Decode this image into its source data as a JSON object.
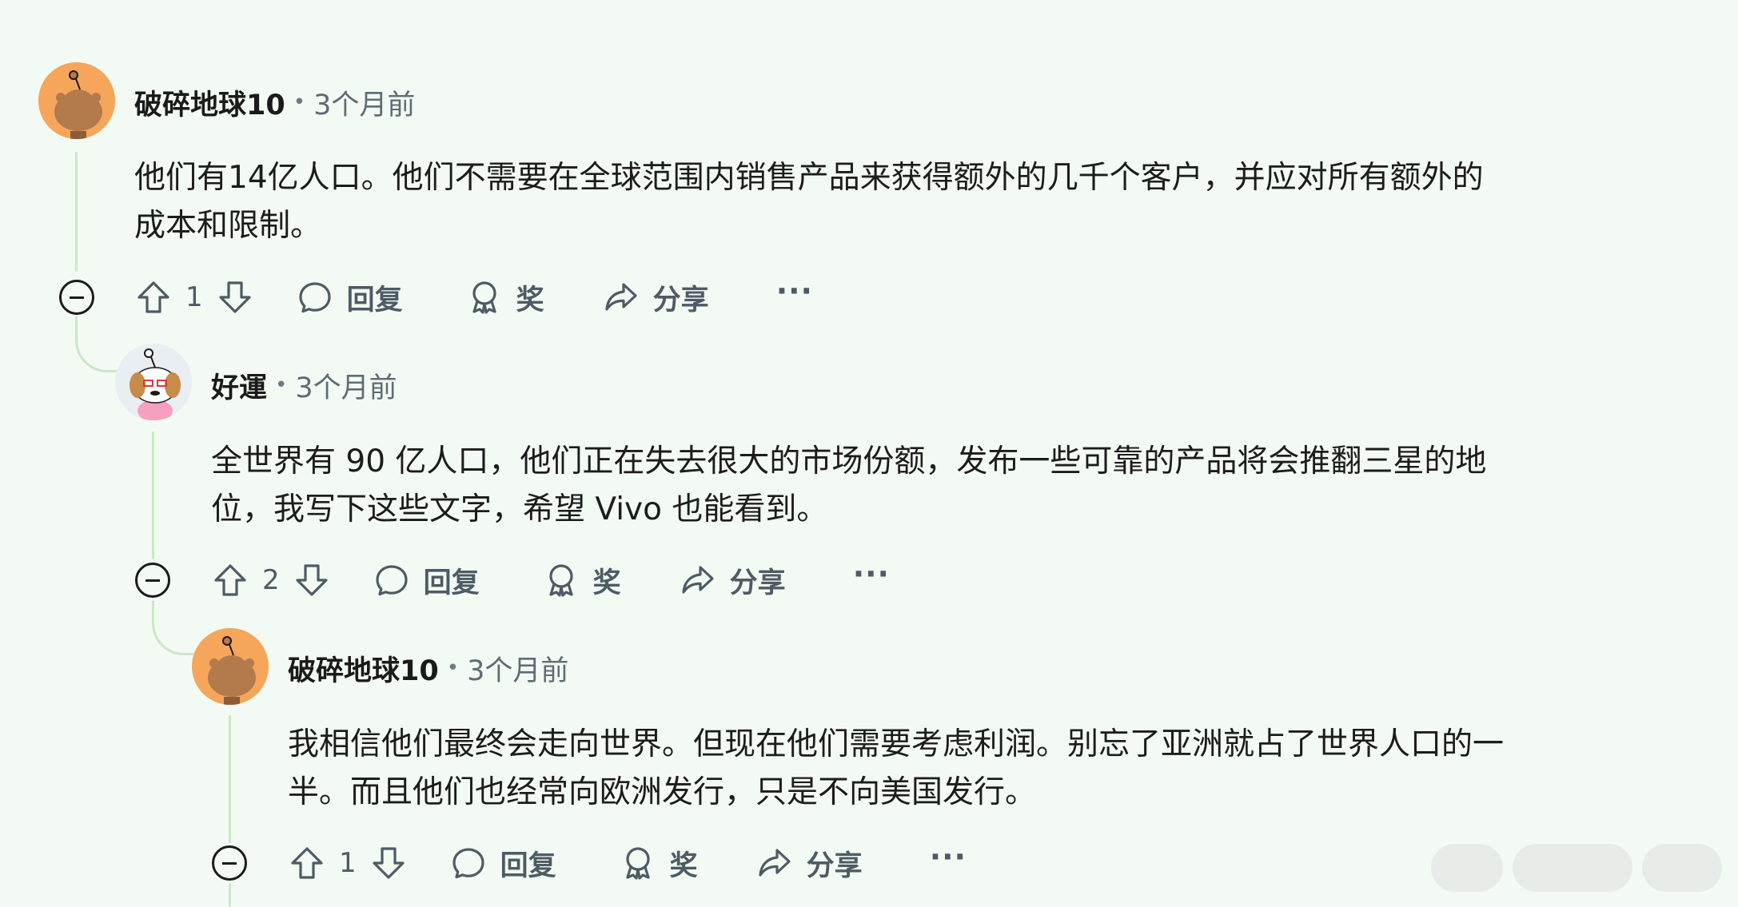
{
  "comments": [
    {
      "author": "破碎地球10",
      "separator": "•",
      "time": "3个月前",
      "body_line1": "他们有14亿人口。他们不需要在全球范围内销售产品来获得额外的几千个客户，并应对所有额外的",
      "body_line2": "成本和限制。",
      "votes": "1",
      "reply_label": "回复",
      "award_label": "奖",
      "share_label": "分享",
      "more_label": "···"
    },
    {
      "author": "好運",
      "separator": "•",
      "time": "3个月前",
      "body_line1": "全世界有 90 亿人口，他们正在失去很大的市场份额，发布一些可靠的产品将会推翻三星的地",
      "body_line2": "位，我写下这些文字，希望 Vivo 也能看到。",
      "votes": "2",
      "reply_label": "回复",
      "award_label": "奖",
      "share_label": "分享",
      "more_label": "···"
    },
    {
      "author": "破碎地球10",
      "separator": "•",
      "time": "3个月前",
      "body_line1": "我相信他们最终会走向世界。但现在他们需要考虑利润。别忘了亚洲就占了世界人口的一",
      "body_line2": "半。而且他们也经常向欧洲发行，只是不向美国发行。",
      "votes": "1",
      "reply_label": "回复",
      "award_label": "奖",
      "share_label": "分享",
      "more_label": "···"
    }
  ],
  "colors": {
    "background": "#f3faf3",
    "thread_line": "#c8e8c8",
    "avatar_orange": "#f5a65b",
    "meta_text": "#5d6c76"
  },
  "icons": [
    "upvote-icon",
    "downvote-icon",
    "reply-icon",
    "award-icon",
    "share-icon",
    "collapse-icon"
  ]
}
